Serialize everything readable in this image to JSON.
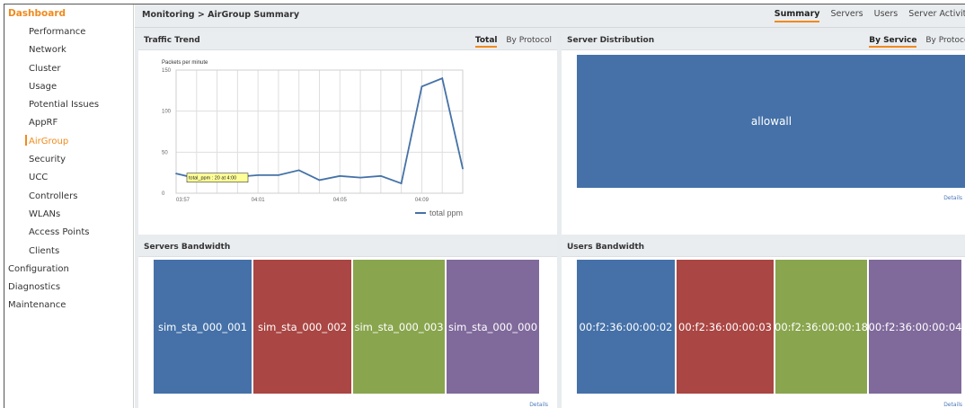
{
  "sidebar": {
    "dashboard": "Dashboard",
    "sub_items": [
      {
        "label": "Performance",
        "name": "sidebar-item-performance"
      },
      {
        "label": "Network",
        "name": "sidebar-item-network"
      },
      {
        "label": "Cluster",
        "name": "sidebar-item-cluster"
      },
      {
        "label": "Usage",
        "name": "sidebar-item-usage"
      },
      {
        "label": "Potential Issues",
        "name": "sidebar-item-potential-issues"
      },
      {
        "label": "AppRF",
        "name": "sidebar-item-apprf"
      },
      {
        "label": "AirGroup",
        "name": "sidebar-item-airgroup",
        "active": true
      },
      {
        "label": "Security",
        "name": "sidebar-item-security"
      },
      {
        "label": "UCC",
        "name": "sidebar-item-ucc"
      },
      {
        "label": "Controllers",
        "name": "sidebar-item-controllers"
      },
      {
        "label": "WLANs",
        "name": "sidebar-item-wlans"
      },
      {
        "label": "Access Points",
        "name": "sidebar-item-access-points"
      },
      {
        "label": "Clients",
        "name": "sidebar-item-clients"
      }
    ],
    "main_items": [
      {
        "label": "Configuration",
        "name": "sidebar-item-configuration"
      },
      {
        "label": "Diagnostics",
        "name": "sidebar-item-diagnostics"
      },
      {
        "label": "Maintenance",
        "name": "sidebar-item-maintenance"
      }
    ]
  },
  "header": {
    "breadcrumb": "Monitoring > AirGroup Summary",
    "tabs": [
      "Summary",
      "Servers",
      "Users",
      "Server Activity"
    ]
  },
  "traffic_trend": {
    "title": "Traffic Trend",
    "tabs": [
      "Total",
      "By Protocol"
    ],
    "y_label": "Packets per minute",
    "tooltip": "total_ppm : 20 at 4:00",
    "legend": "total ppm"
  },
  "server_distribution": {
    "title": "Server Distribution",
    "tabs": [
      "By Service",
      "By Protocol"
    ],
    "tile_label": "allowall",
    "details": "Details"
  },
  "servers_bandwidth": {
    "title": "Servers Bandwidth",
    "tiles": [
      "sim_sta_000_001",
      "sim_sta_000_002",
      "sim_sta_000_003",
      "sim_sta_000_000"
    ],
    "details": "Details"
  },
  "users_bandwidth": {
    "title": "Users Bandwidth",
    "tiles": [
      "00:f2:36:00:00:02",
      "00:f2:36:00:00:03",
      "00:f2:36:00:00:18",
      "00:f2:36:00:00:04"
    ],
    "details": "Details"
  },
  "colors": {
    "accent": "#f08a1c",
    "tile_blue": "#4571a8",
    "tile_red": "#aa4643",
    "tile_green": "#89a54e",
    "tile_purple": "#80699b",
    "line": "#4572a7"
  },
  "chart_data": {
    "type": "line",
    "ylabel": "Packets per minute",
    "ylim": [
      0,
      150
    ],
    "yticks": [
      0,
      50,
      100,
      150
    ],
    "xticks": [
      "03:57",
      "04:01",
      "04:05",
      "04:09"
    ],
    "grid": true,
    "legend_position": "bottom-right",
    "series": [
      {
        "name": "total ppm",
        "x": [
          "03:57",
          "03:58",
          "03:59",
          "04:00",
          "04:01",
          "04:02",
          "04:03",
          "04:04",
          "04:05",
          "04:06",
          "04:07",
          "04:08",
          "04:09",
          "04:10",
          "04:11"
        ],
        "values": [
          24,
          18,
          22,
          20,
          22,
          22,
          28,
          16,
          21,
          19,
          21,
          12,
          130,
          140,
          30
        ]
      }
    ]
  }
}
